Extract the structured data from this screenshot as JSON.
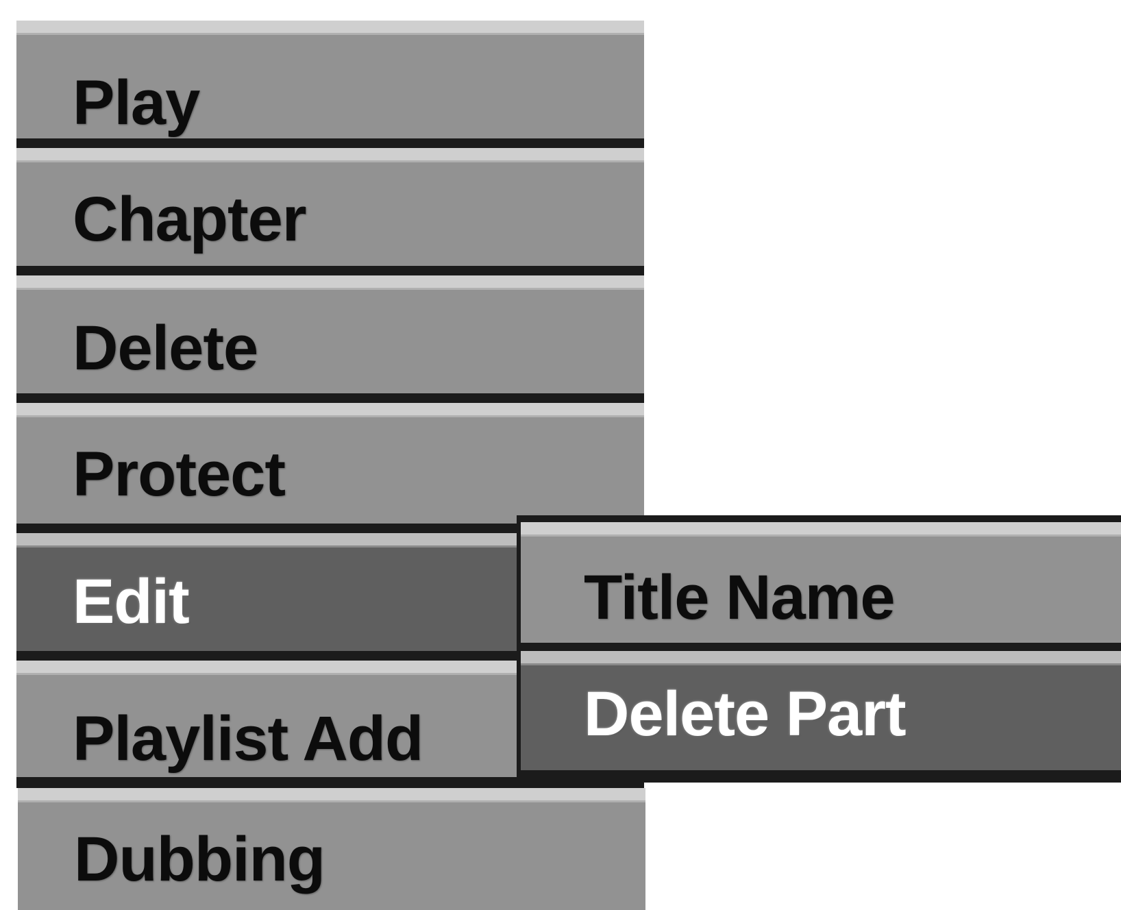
{
  "menu": {
    "items": [
      {
        "label": "Play",
        "selected": false
      },
      {
        "label": "Chapter",
        "selected": false
      },
      {
        "label": "Delete",
        "selected": false
      },
      {
        "label": "Protect",
        "selected": false
      },
      {
        "label": "Edit",
        "selected": true
      },
      {
        "label": "Playlist Add",
        "selected": false
      },
      {
        "label": "Dubbing",
        "selected": false
      }
    ]
  },
  "submenu": {
    "parent": "Edit",
    "items": [
      {
        "label": "Title Name",
        "selected": false
      },
      {
        "label": "Delete Part",
        "selected": true
      }
    ]
  },
  "colors": {
    "item_background": "#929292",
    "selected_background": "#5f5f5f",
    "separator": "#1b1b1b",
    "text": "#0c0c0c",
    "selected_text": "#ffffff"
  }
}
